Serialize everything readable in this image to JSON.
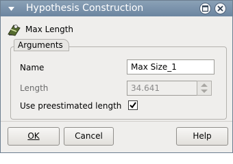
{
  "window": {
    "title": "Hypothesis Construction",
    "menu_icon": "window-menu-icon",
    "maximize_icon": "maximize-icon",
    "close_icon": "close-icon"
  },
  "hypothesis": {
    "icon": "hypothesis-icon",
    "name": "Max Length"
  },
  "arguments": {
    "group_label": "Arguments",
    "name_label": "Name",
    "name_value": "Max Size_1",
    "length_label": "Length",
    "length_value": "34.641",
    "preestimated_label": "Use preestimated length",
    "preestimated_checked": true
  },
  "buttons": {
    "ok": "OK",
    "cancel": "Cancel",
    "help": "Help"
  },
  "colors": {
    "titlebar": "#7a93ab",
    "dialog_bg": "#efeeec"
  }
}
